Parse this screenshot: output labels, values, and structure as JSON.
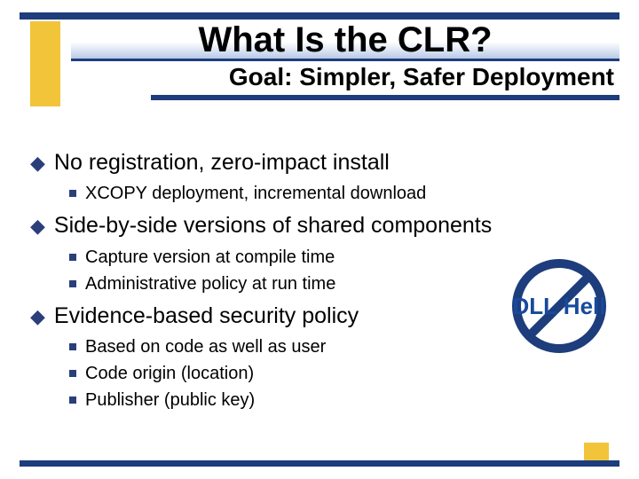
{
  "title": "What Is the CLR?",
  "subtitle": "Goal: Simpler, Safer Deployment",
  "bullets": [
    {
      "text": "No registration, zero-impact install",
      "sub": [
        "XCOPY deployment, incremental download"
      ]
    },
    {
      "text": "Side-by-side versions of shared components",
      "sub": [
        "Capture version at compile time",
        "Administrative policy at run time"
      ]
    },
    {
      "text": "Evidence-based security policy",
      "sub": [
        "Based on code as well as user",
        "Code origin (location)",
        "Publisher (public key)"
      ]
    }
  ],
  "callout": "DLL Hell"
}
